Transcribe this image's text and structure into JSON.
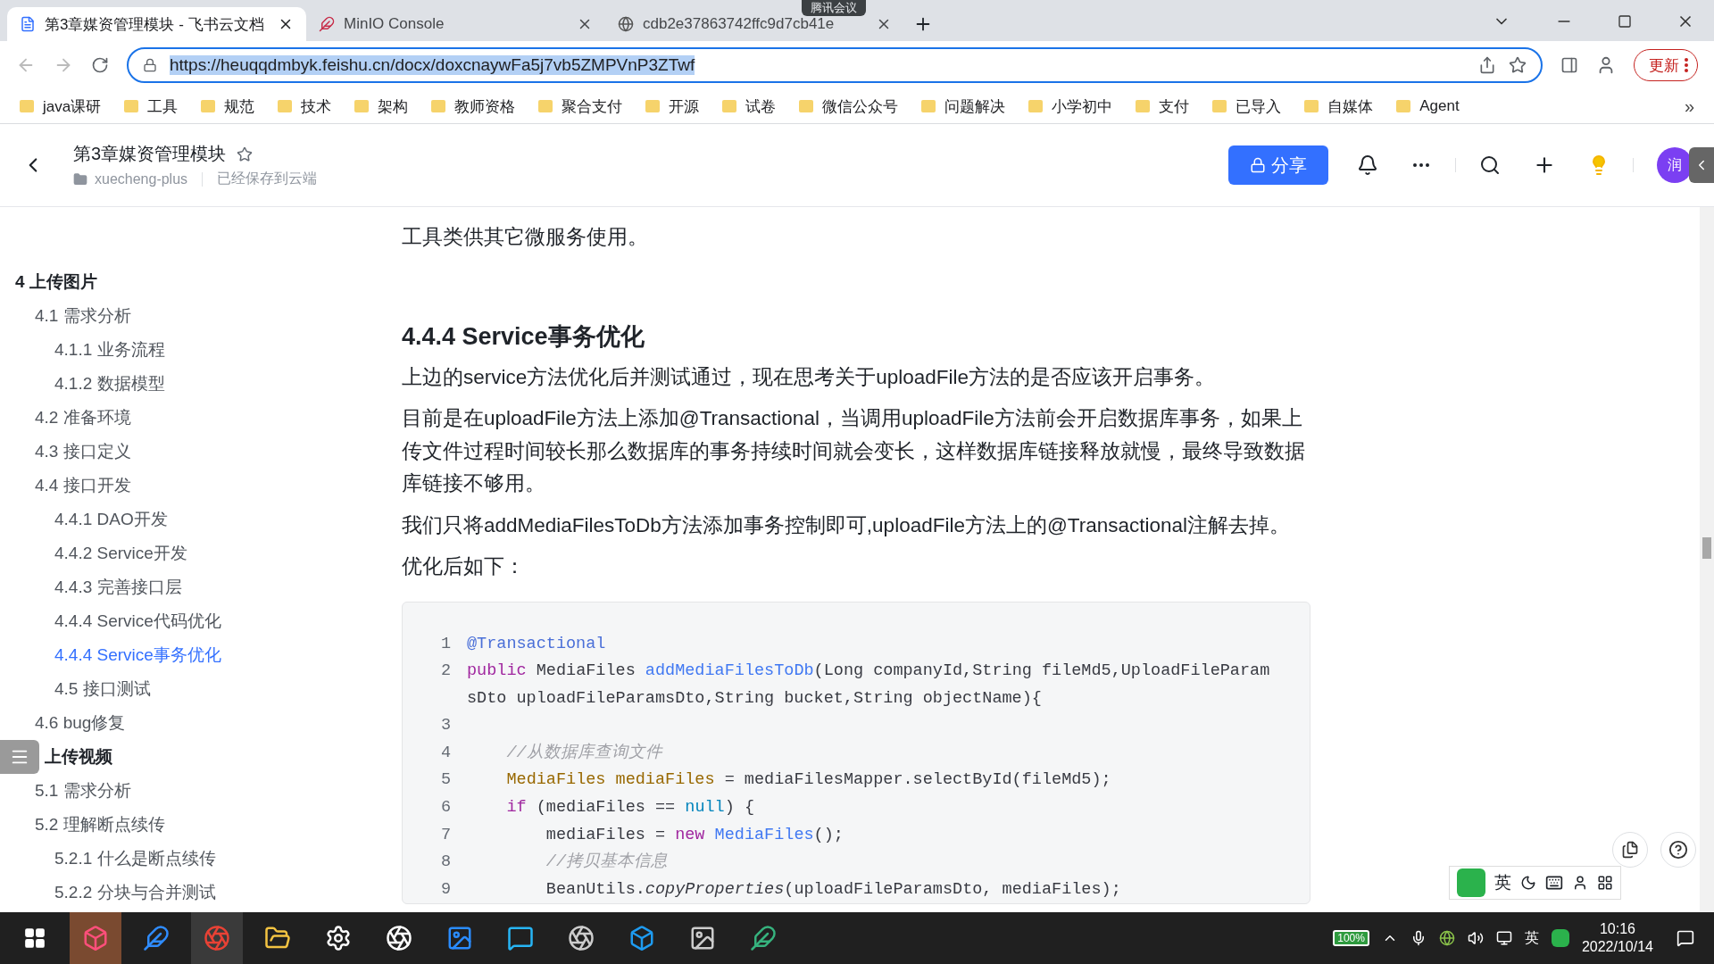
{
  "browser": {
    "tabs": [
      {
        "title": "第3章媒资管理模块 - 飞书云文档",
        "kind": "doc",
        "selected": true
      },
      {
        "title": "MinIO Console",
        "kind": "minio",
        "selected": false
      },
      {
        "title": "cdb2e37863742ffc9d7cb41e",
        "kind": "web",
        "selected": false
      }
    ],
    "meeting_badge": "腾讯会议",
    "url": "https://heuqqdmbyk.feishu.cn/docx/doxcnaywFa5j7vb5ZMPVnP3ZTwf",
    "update_button": "更新",
    "bookmarks": [
      "java课研",
      "工具",
      "规范",
      "技术",
      "架构",
      "教师资格",
      "聚合支付",
      "开源",
      "试卷",
      "微信公众号",
      "问题解决",
      "小学初中",
      "支付",
      "已导入",
      "自媒体",
      "Agent"
    ],
    "bookmarks_more": "»"
  },
  "doc_header": {
    "title": "第3章媒资管理模块",
    "folder": "xuecheng-plus",
    "save_status": "已经保存到云端",
    "share_button": "分享",
    "avatar": "润"
  },
  "outline": [
    {
      "label": "4 上传图片",
      "selected": false,
      "children": [
        {
          "label": "4.1 需求分析",
          "selected": false,
          "children": [
            {
              "label": "4.1.1 业务流程",
              "selected": false
            },
            {
              "label": "4.1.2 数据模型",
              "selected": false
            }
          ]
        },
        {
          "label": "4.2 准备环境",
          "selected": false
        },
        {
          "label": "4.3 接口定义",
          "selected": false
        },
        {
          "label": "4.4 接口开发",
          "selected": false,
          "children": [
            {
              "label": "4.4.1 DAO开发",
              "selected": false
            },
            {
              "label": "4.4.2 Service开发",
              "selected": false
            },
            {
              "label": "4.4.3 完善接口层",
              "selected": false
            },
            {
              "label": "4.4.4 Service代码优化",
              "selected": false
            },
            {
              "label": "4.4.4 Service事务优化",
              "selected": true
            },
            {
              "label": "4.5 接口测试",
              "selected": false
            }
          ]
        },
        {
          "label": "4.6 bug修复",
          "selected": false
        }
      ]
    },
    {
      "label": "上传视频",
      "selected": false,
      "children": [
        {
          "label": "5.1 需求分析",
          "selected": false
        },
        {
          "label": "5.2 理解断点续传",
          "selected": false,
          "children": [
            {
              "label": "5.2.1 什么是断点续传",
              "selected": false
            },
            {
              "label": "5.2.2 分块与合并测试",
              "selected": false
            }
          ]
        }
      ]
    }
  ],
  "article": {
    "intro": "工具类供其它微服务使用。",
    "heading": "4.4.4 Service事务优化",
    "paragraphs": [
      "上边的service方法优化后并测试通过，现在思考关于uploadFile方法的是否应该开启事务。",
      "目前是在uploadFile方法上添加@Transactional，当调用uploadFile方法前会开启数据库事务，如果上传文件过程时间较长那么数据库的事务持续时间就会变长，这样数据库链接释放就慢，最终导致数据库链接不够用。",
      "我们只将addMediaFilesToDb方法添加事务控制即可,uploadFile方法上的@Transactional注解去掉。",
      "优化后如下："
    ],
    "code": [
      {
        "number": "1",
        "tokens": [
          {
            "text": "@Transactional",
            "kind": "annotation"
          }
        ]
      },
      {
        "number": "2",
        "tokens": [
          {
            "text": "public",
            "kind": "keyword"
          },
          {
            "text": " MediaFiles ",
            "kind": "plain"
          },
          {
            "text": "addMediaFilesToDb",
            "kind": "func"
          },
          {
            "text": "(Long companyId,String fileMd5,UploadFileParamsDto uploadFileParamsDto,String bucket,String objectName){",
            "kind": "plain"
          }
        ]
      },
      {
        "number": "3"
      },
      {
        "number": "4",
        "tokens": [
          {
            "text": "    //从数据库查询文件",
            "kind": "comment"
          }
        ]
      },
      {
        "number": "5",
        "tokens": [
          {
            "text": "    MediaFiles mediaFiles",
            "kind": "type"
          },
          {
            "text": " = mediaFilesMapper.selectById(fileMd5);",
            "kind": "plain"
          }
        ]
      },
      {
        "number": "6",
        "tokens": [
          {
            "text": "    if",
            "kind": "keyword"
          },
          {
            "text": " (mediaFiles == ",
            "kind": "plain"
          },
          {
            "text": "null",
            "kind": "literal"
          },
          {
            "text": ") {",
            "kind": "plain"
          }
        ]
      },
      {
        "number": "7",
        "tokens": [
          {
            "text": "        mediaFiles = ",
            "kind": "plain"
          },
          {
            "text": "new",
            "kind": "keyword"
          },
          {
            "text": " MediaFiles",
            "kind": "func"
          },
          {
            "text": "();",
            "kind": "plain"
          }
        ]
      },
      {
        "number": "8",
        "tokens": [
          {
            "text": "        //拷贝基本信息",
            "kind": "comment"
          }
        ]
      },
      {
        "number": "9",
        "tokens": [
          {
            "text": "        BeanUtils.",
            "kind": "plain"
          },
          {
            "text": "copyProperties",
            "kind": "italic"
          },
          {
            "text": "(uploadFileParamsDto, mediaFiles);",
            "kind": "plain"
          }
        ]
      }
    ]
  },
  "ime_toolbar": {
    "language": "英"
  },
  "taskbar": {
    "battery": "100%",
    "ime": "英",
    "time": "10:16",
    "date": "2022/10/14"
  }
}
